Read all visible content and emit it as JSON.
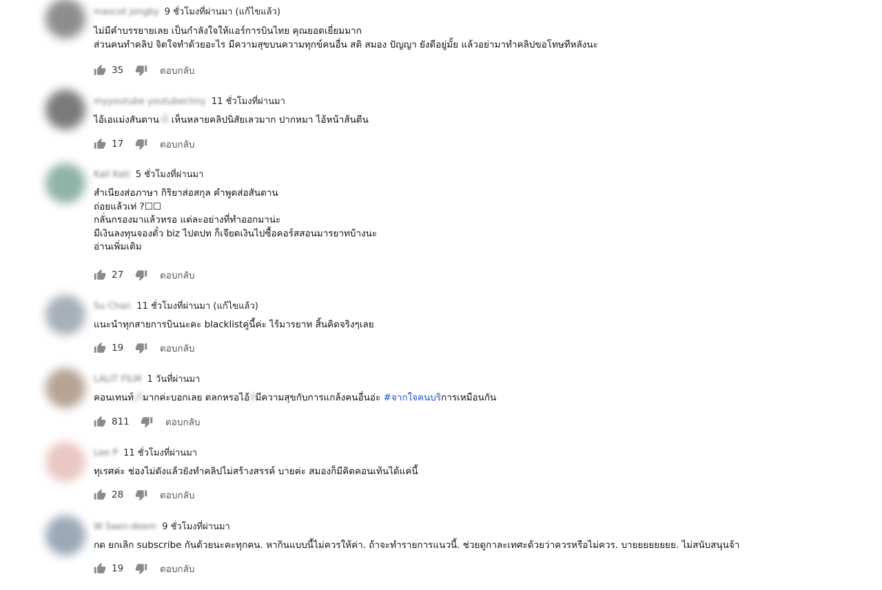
{
  "comments": [
    {
      "author": "mascot jongky",
      "time": "9 ชั่วโมงที่ผ่านมา",
      "edited": "(แก้ไขแล้ว)",
      "lines": [
        "ไม่มีคำบรรยายเลย เป็นกำลังใจให้แอร์การบินไทย คุณยอดเยี่ยมมาก",
        "ส่วนคนทำคลิป จิตใจทำด้วยอะไร มีความสุขบนความทุกข์คนอื่น สติ สมอง ปัญญา ยังดีอยู่มั้ย แล้วอย่ามาทำคลิปขอโทษทีหลังนะ"
      ],
      "likes": "35",
      "reply": "ตอบกลับ"
    },
    {
      "author": "myyoutube youtubechny",
      "time": "11 ชั่วโมงที่ผ่านมา",
      "edited": "",
      "line_pre": "ไอ้เอแม่งสันดาน",
      "line_blur": "เห็",
      "line_post": " เห็นหลายคลิปนิสัยเลวมาก ปากหมา ไอ้หน้าส้นตีน",
      "likes": "17",
      "reply": "ตอบกลับ"
    },
    {
      "author": "Kall Katl",
      "time": "5 ชั่วโมงที่ผ่านมา",
      "edited": "",
      "lines": [
        "สำเนียงส่อภาษา กิริยาส่อสกุล คำพูดส่อสันดาน",
        "ถ่อยแล้วเท่ ?☐☐",
        "กลั่นกรองมาแล้วหรอ แต่ละอย่างที่ทำออกมาน่ะ",
        "มีเงินลงทุนจองตั๋ว biz ไปตปท ก็เจียดเงินไปซื้อคอร์สสอนมารยาทบ้างนะ",
        "อ่านเพิ่มเติม"
      ],
      "likes": "27",
      "reply": "ตอบกลับ"
    },
    {
      "author": "Su Chan",
      "time": "11 ชั่วโมงที่ผ่านมา",
      "edited": "(แก้ไขแล้ว)",
      "lines": [
        "แนะนำทุกสายการบินนะคะ blacklistคู่นี้ค่ะ ไร้มารยาท สิ้นคิดจริงๆเลย"
      ],
      "likes": "19",
      "reply": "ตอบกลับ"
    },
    {
      "author": "LALIT FILM",
      "time": "1 วันที่ผ่านมา",
      "edited": "",
      "line_a": "คอนเทนท์",
      "line_a_blur": "เกี",
      "line_b": "มากค่ะบอกเลย ตลกหรอไอ้",
      "line_b_blur": "สั",
      "line_c": "มีความสุขกับการแกล้งคนอื่นอ่ะ ",
      "line_tag": "#จากใจคนบริ",
      "line_d": "การเหมือนกัน",
      "likes": "811",
      "reply": "ตอบกลับ"
    },
    {
      "author": "Lee P",
      "time": "11 ชั่วโมงที่ผ่านมา",
      "edited": "",
      "lines": [
        "ทุเรศค่ะ ช่องไม่ดังแล้วยังทำคลิปไม่สร้างสรรค์ บายค่ะ สมองก็มีคิดคอนเท้นได้แค่นี้"
      ],
      "likes": "28",
      "reply": "ตอบกลับ"
    },
    {
      "author": "W Saen-deem",
      "time": "9 ชั่วโมงที่ผ่านมา",
      "edited": "",
      "lines": [
        "กด ยกเลิก subscribe กันด้วยนะคะทุกคน. หากินแบบนี้ไม่ควรให้ค่า. ถ้าจะทำรายการแนวนี้. ช่วยดูกาละเทศะด้วยว่าควรหรือไม่ควร.  บายยยยยยยย. ไม่สนับสนุนจ้า"
      ],
      "likes": "19",
      "reply": "ตอบกลับ"
    }
  ],
  "colors": {
    "hashtag": "#1a56c6",
    "icon": "#8a8a8a",
    "avatars": [
      "#8d8d8d",
      "#7a7a7a",
      "#8fb3a6",
      "#a7afb8",
      "#b6a394",
      "#e9c7c2",
      "#9aa8b8"
    ]
  },
  "icons": {
    "like": "thumbs-up-icon",
    "dislike": "thumbs-down-icon"
  }
}
